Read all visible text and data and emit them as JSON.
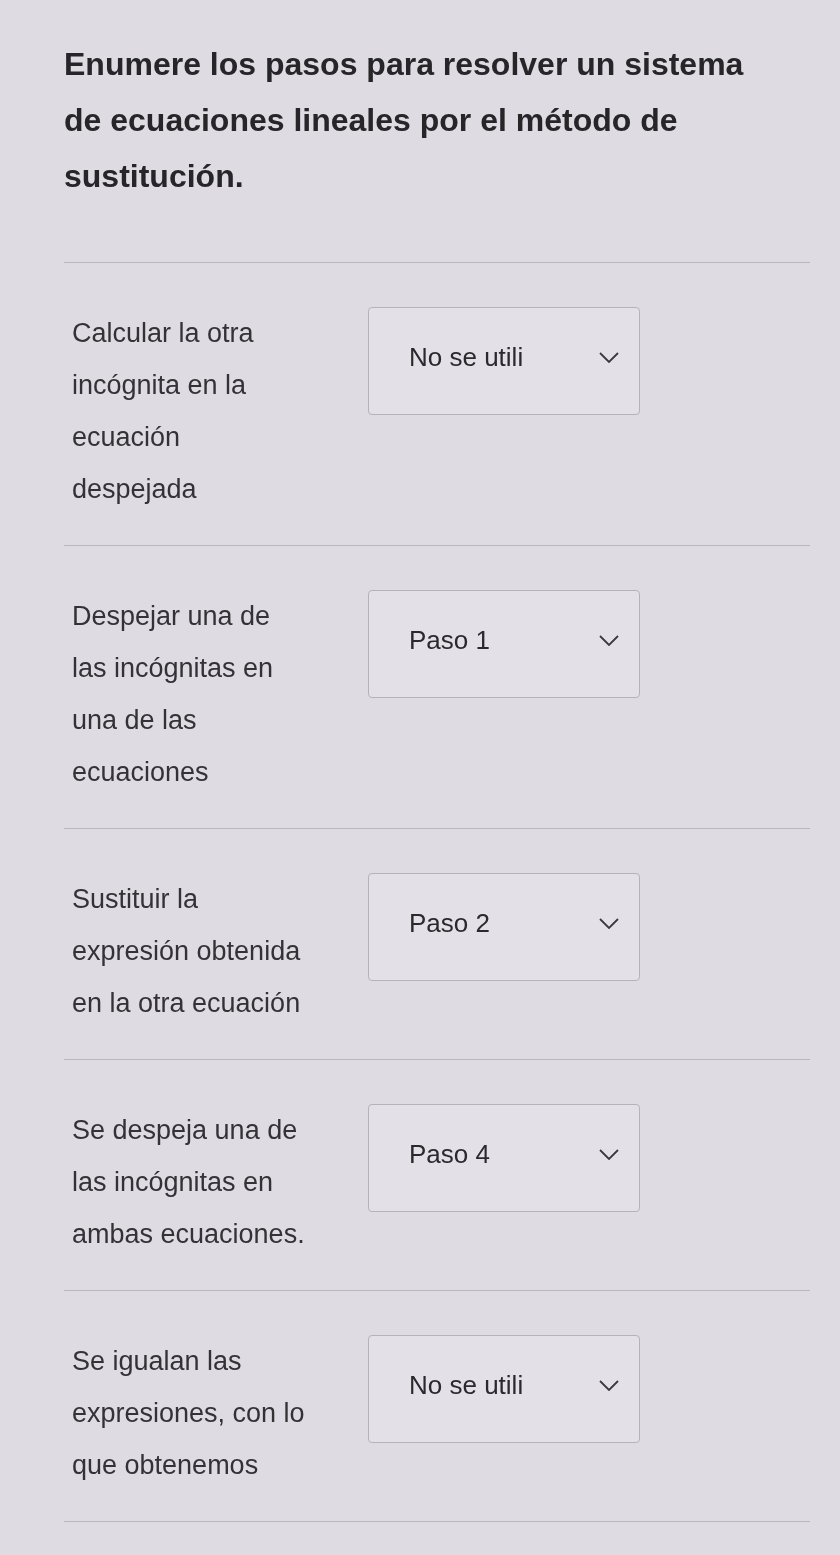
{
  "question": "Enumere los pasos para resolver un sistema de ecuaciones lineales por el método de sustitución.",
  "items": [
    {
      "label": "Calcular la otra\nincógnita en la\necuación\ndespejada",
      "value": "No se utili"
    },
    {
      "label": "Despejar una de\nlas incógnitas en\nuna de las\necuaciones",
      "value": "Paso 1"
    },
    {
      "label": "Sustituir la\nexpresión obtenida\nen la otra ecuación",
      "value": "Paso 2"
    },
    {
      "label": "Se despeja una de\nlas incógnitas en\nambas ecuaciones.",
      "value": "Paso 4"
    },
    {
      "label": "Se igualan las\nexpresiones, con lo\nque obtenemos",
      "value": "No se utili"
    }
  ]
}
